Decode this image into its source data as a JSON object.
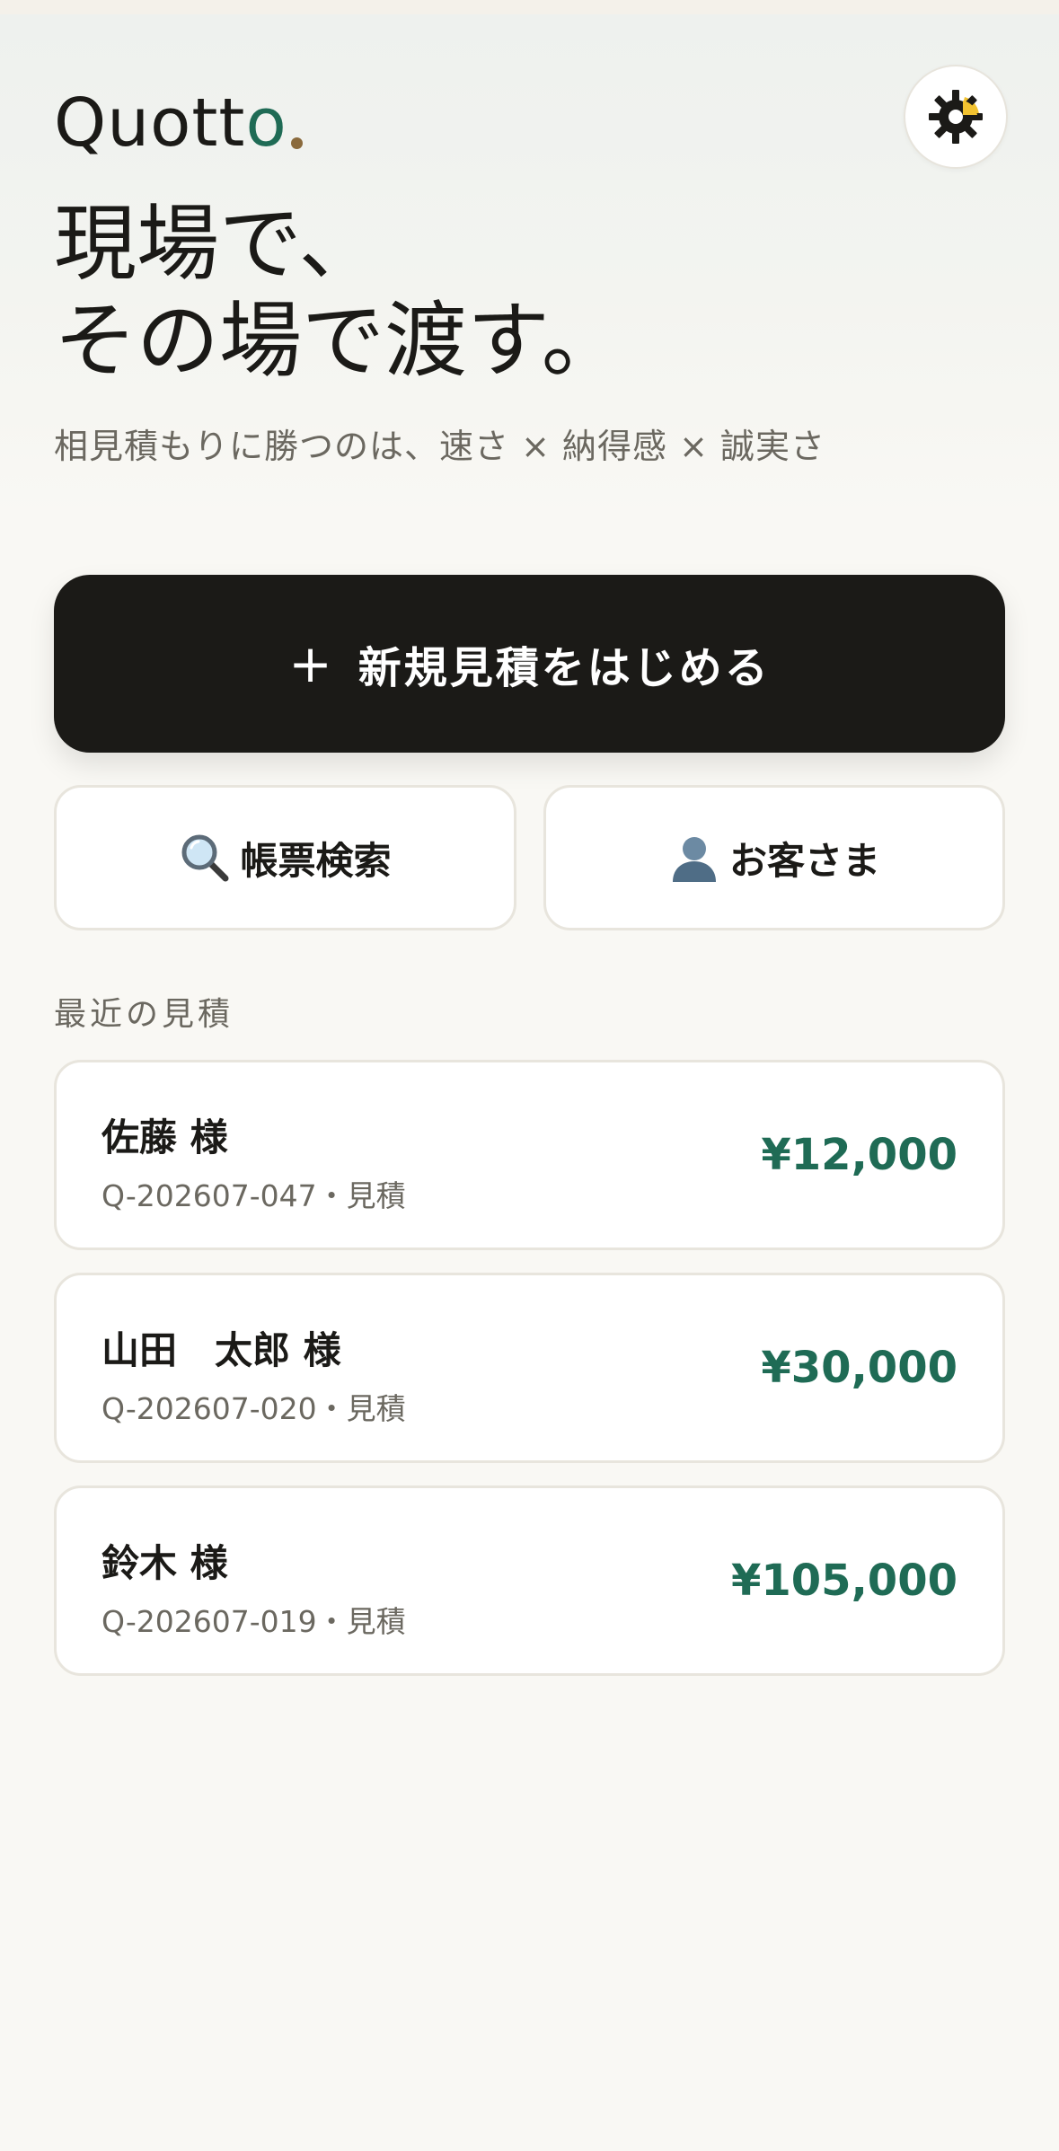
{
  "brand": {
    "logo_main": "Quott",
    "logo_accent": "o",
    "accent_color": "#1f6b55",
    "dot_color": "#8a6a3c"
  },
  "header": {
    "theme_icon": "sun-gear-icon"
  },
  "hero": {
    "line1": "現場で、",
    "line2": "その場で渡す。",
    "subtitle": "相見積もりに勝つのは、速さ × 納得感 × 誠実さ"
  },
  "actions": {
    "new_quote_icon": "+",
    "new_quote_label": "新規見積をはじめる",
    "search_icon": "magnifier-icon",
    "search_label": "帳票検索",
    "customers_icon": "person-icon",
    "customers_label": "お客さま"
  },
  "recent": {
    "title": "最近の見積",
    "items": [
      {
        "name": "佐藤 様",
        "meta": "Q-202607-047・見積",
        "amount": "¥12,000"
      },
      {
        "name": "山田　太郎 様",
        "meta": "Q-202607-020・見積",
        "amount": "¥30,000"
      },
      {
        "name": "鈴木 様",
        "meta": "Q-202607-019・見積",
        "amount": "¥105,000"
      }
    ]
  }
}
